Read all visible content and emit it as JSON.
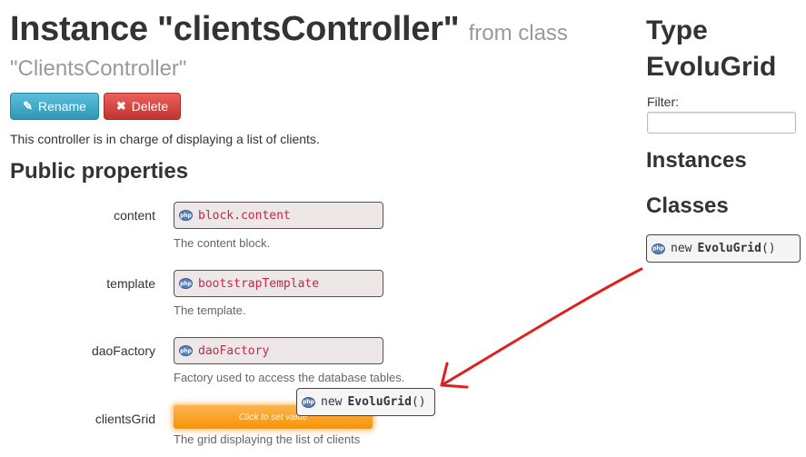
{
  "header": {
    "title": "Instance \"clientsController\"",
    "from_text": "from class",
    "class_name": "\"ClientsController\""
  },
  "actions": {
    "rename_label": "Rename",
    "delete_label": "Delete"
  },
  "description": "This controller is in charge of displaying a list of clients.",
  "public_properties": {
    "heading": "Public properties",
    "items": [
      {
        "name": "content",
        "value": "block.content",
        "help": "The content block."
      },
      {
        "name": "template",
        "value": "bootstrapTemplate",
        "help": "The template."
      },
      {
        "name": "daoFactory",
        "value": "daoFactory",
        "help": "Factory used to access the database tables."
      },
      {
        "name": "clientsGrid",
        "placeholder": "Click to set value",
        "help": "The grid displaying the list of clients"
      }
    ]
  },
  "dragged_item": {
    "keyword": "new",
    "class": "EvoluGrid",
    "suffix": "()"
  },
  "sidebar": {
    "title": "Type EvoluGrid",
    "filter_label": "Filter:",
    "filter_value": "",
    "instances_heading": "Instances",
    "classes_heading": "Classes",
    "class_item": {
      "keyword": "new",
      "class": "EvoluGrid",
      "suffix": "()"
    }
  },
  "badge_text": "php",
  "colors": {
    "rename": "#5bc0de",
    "delete": "#ee5f5b",
    "value_text": "#c7254e",
    "drop_target": "#f89406",
    "arrow": "#e0201c"
  }
}
